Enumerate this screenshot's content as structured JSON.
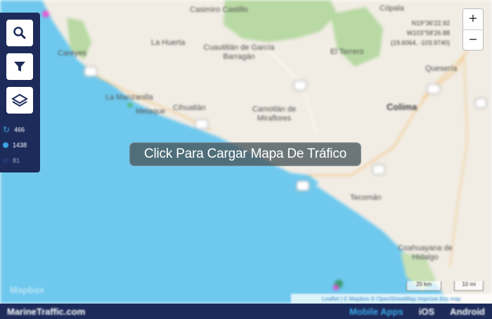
{
  "map": {
    "overlay_text": "Click Para Cargar Mapa De Tráfico",
    "watermark": "Mapbox",
    "coordinates": [
      "N19°36'22.92",
      "W103°58'26.88",
      "(19.6064, -103.9740)"
    ],
    "places": [
      {
        "name": "Casimiro Castillo",
        "kind": "small"
      },
      {
        "name": "Cuautitlán de García Barragán",
        "kind": "small"
      },
      {
        "name": "La Huerta",
        "kind": "small"
      },
      {
        "name": "El Terrero",
        "kind": "small"
      },
      {
        "name": "Cihuatlán",
        "kind": "small"
      },
      {
        "name": "La Manzanilla",
        "kind": "small"
      },
      {
        "name": "Melaque",
        "kind": "small"
      },
      {
        "name": "Camotlán de Miraflores",
        "kind": "small"
      },
      {
        "name": "Colima",
        "kind": "big"
      },
      {
        "name": "Quesería",
        "kind": "small"
      },
      {
        "name": "Tecomán",
        "kind": "small"
      },
      {
        "name": "Coahuayana de Hidalgo",
        "kind": "small"
      },
      {
        "name": "Careyes",
        "kind": "small"
      },
      {
        "name": "Cópala",
        "kind": "small"
      }
    ],
    "scale": {
      "metric": "20 km",
      "imperial": "10 mi"
    },
    "attribution": "Leaflet | © Mapbox © OpenStreetMap Improve this map",
    "colors": {
      "sea": "#6fc9ee",
      "land": "#f1ece4",
      "forest": "#b8d9a3",
      "ui_navy": "#1d2b5b"
    }
  },
  "toolbar": {
    "stats": [
      {
        "icon": "refresh-icon",
        "value": "466"
      },
      {
        "icon": "vessel-dot-icon",
        "value": "1438"
      },
      {
        "icon": "dark-dot-icon",
        "value": "81"
      }
    ],
    "buttons": [
      "search-icon",
      "filter-icon",
      "layers-icon"
    ]
  },
  "zoom": {
    "plus": "+",
    "minus": "−"
  },
  "footer": {
    "brand": "MarineTraffic.com",
    "mobile_label": "Mobile Apps",
    "ios": "iOS",
    "android": "Android"
  }
}
